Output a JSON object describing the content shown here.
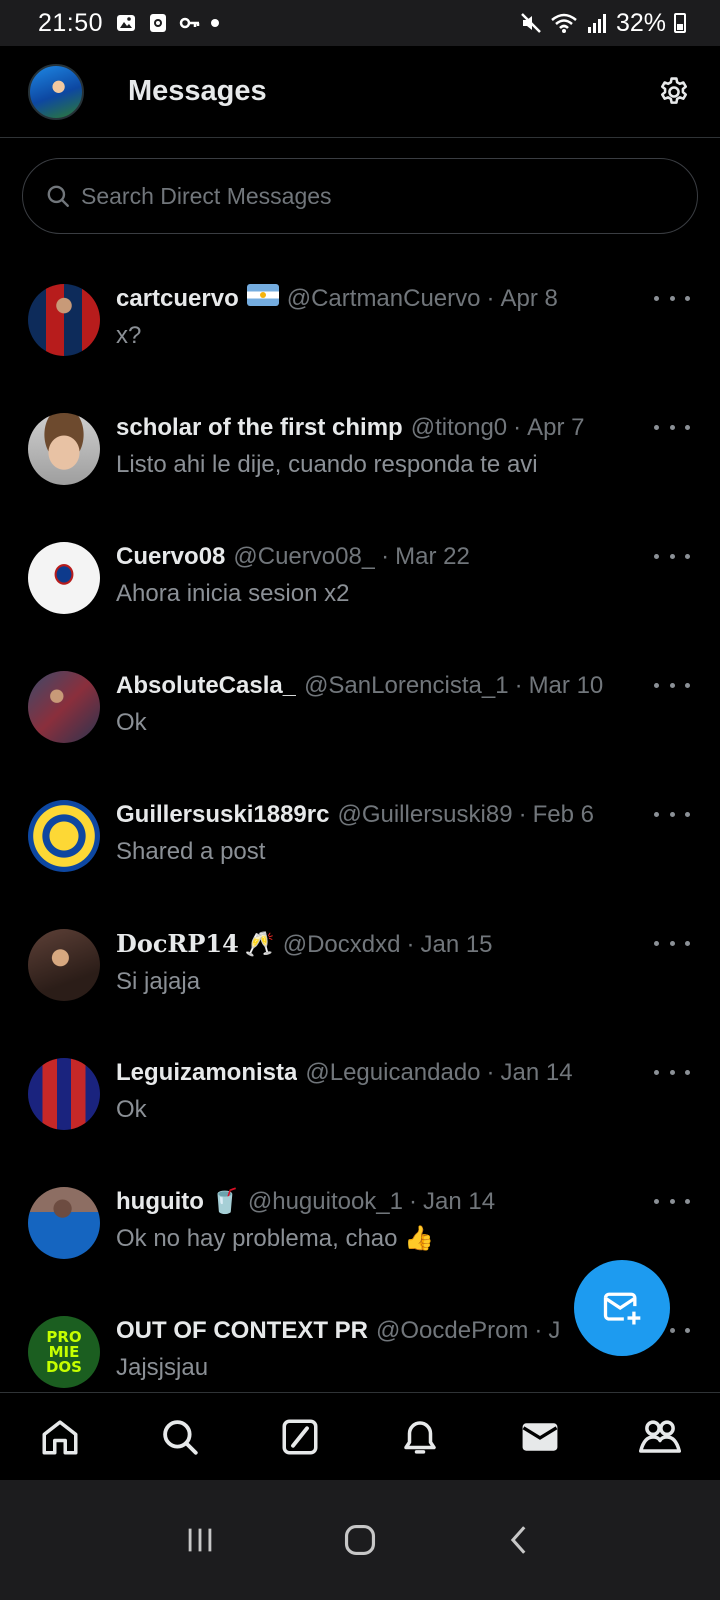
{
  "status_bar": {
    "time": "21:50",
    "battery": "32%"
  },
  "header": {
    "title": "Messages"
  },
  "search": {
    "placeholder": "Search Direct Messages"
  },
  "conversations": [
    {
      "name": "cartcuervo",
      "badge": "flag-ar",
      "handle": "@CartmanCuervo",
      "date": "Apr 8",
      "preview": "x?"
    },
    {
      "name": "scholar of the first chimp",
      "handle": "@titong0",
      "date": "Apr 7",
      "preview": "Listo ahi le dije, cuando responda te avi"
    },
    {
      "name": "Cuervo08",
      "handle": "@Cuervo08_",
      "date": "Mar 22",
      "preview": "Ahora inicia sesion x2"
    },
    {
      "name": "AbsoluteCasla_",
      "handle": "@SanLorencista_1",
      "date": "Mar 10",
      "preview": "Ok"
    },
    {
      "name": "Guillersuski1889rc",
      "handle": "@Guillersuski89",
      "date": "Feb 6",
      "preview": "Shared a post"
    },
    {
      "name": "DocRP14",
      "emoji": "🥂",
      "handle": "@Docxdxd",
      "date": "Jan 15",
      "preview": "Si jajaja"
    },
    {
      "name": "Leguizamonista",
      "handle": "@Leguicandado",
      "date": "Jan 14",
      "preview": "Ok"
    },
    {
      "name": "huguito",
      "emoji": "🥤",
      "handle": "@huguitook_1",
      "date": "Jan 14",
      "preview": "Ok no hay problema, chao 👍"
    },
    {
      "name": "OUT OF CONTEXT PR",
      "handle": "@OocdeProm",
      "date": "J",
      "preview": "Jajsjsjau"
    }
  ],
  "colors": {
    "accent": "#1d9bf0",
    "background": "#000000",
    "text_primary": "#e7e9ea",
    "text_secondary": "#71767b"
  },
  "icons": {
    "settings": "gear-icon",
    "search": "search-icon",
    "fab": "new-message-icon",
    "nav": [
      "home-icon",
      "search-icon",
      "grok-icon",
      "notifications-bell-icon",
      "messages-envelope-icon",
      "communities-icon"
    ]
  }
}
